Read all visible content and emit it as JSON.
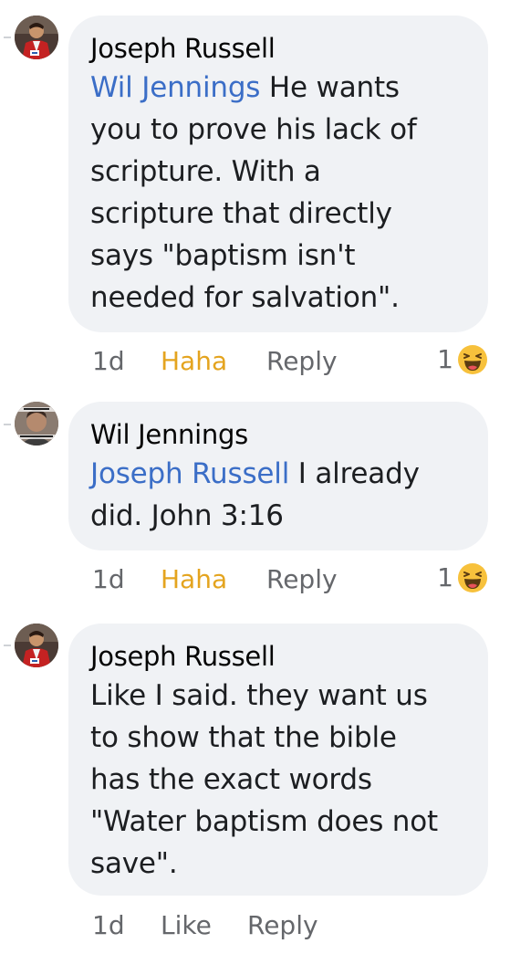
{
  "comments": [
    {
      "author": "Joseph Russell",
      "mention": "Wil Jennings",
      "text": " He wants\nyou to prove his lack of\nscripture.  With a\nscripture that directly\nsays \"baptism isn't\nneeded for salvation\".",
      "time": "1d",
      "reaction_label": "Haha",
      "reply_label": "Reply",
      "reaction_count": "1",
      "reaction_icon": "haha-emoji-icon"
    },
    {
      "author": "Wil Jennings",
      "mention": "Joseph Russell",
      "text": " I already\ndid. John 3:16",
      "time": "1d",
      "reaction_label": "Haha",
      "reply_label": "Reply",
      "reaction_count": "1",
      "reaction_icon": "haha-emoji-icon"
    },
    {
      "author": "Joseph Russell",
      "mention": "",
      "text": "Like I said.  they want us\nto show that the bible\nhas the exact words\n\"Water baptism does not\nsave\".",
      "time": "1d",
      "reaction_label": "Like",
      "reply_label": "Reply",
      "reaction_count": "",
      "reaction_icon": ""
    }
  ],
  "colors": {
    "bubble": "#f0f2f5",
    "mention": "#3b6ec7",
    "haha": "#e4a41f",
    "meta": "#65676b"
  }
}
